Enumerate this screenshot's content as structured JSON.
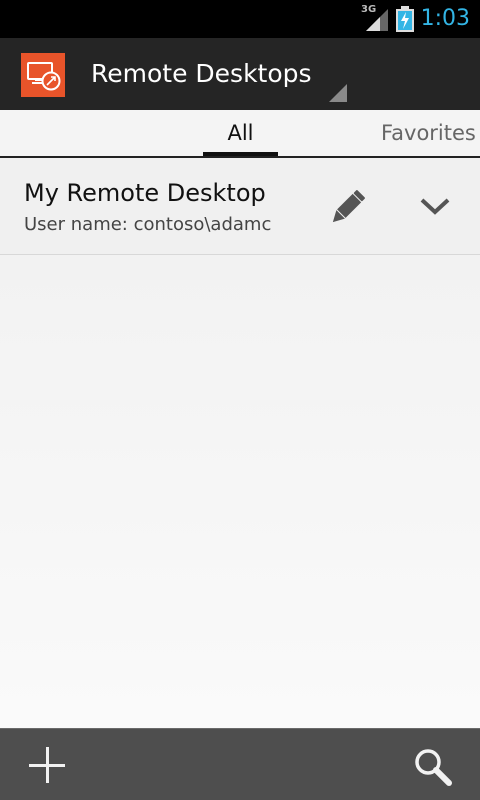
{
  "status_bar": {
    "network": "3G",
    "time": "1:03",
    "time_color": "#33b5e5"
  },
  "action_bar": {
    "title": "Remote Desktops",
    "app_icon": "remote-desktop-icon",
    "icon_color": "#e8542a"
  },
  "tabs": [
    {
      "label": "All",
      "selected": true
    },
    {
      "label": "Favorites",
      "selected": false
    }
  ],
  "desktops": [
    {
      "name": "My Remote Desktop",
      "user_line": "User name: contoso\\adamc",
      "actions": [
        "pencil-icon",
        "chevron-down-icon"
      ]
    }
  ],
  "bottom_bar": {
    "actions": [
      "plus-icon",
      "search-icon"
    ]
  }
}
